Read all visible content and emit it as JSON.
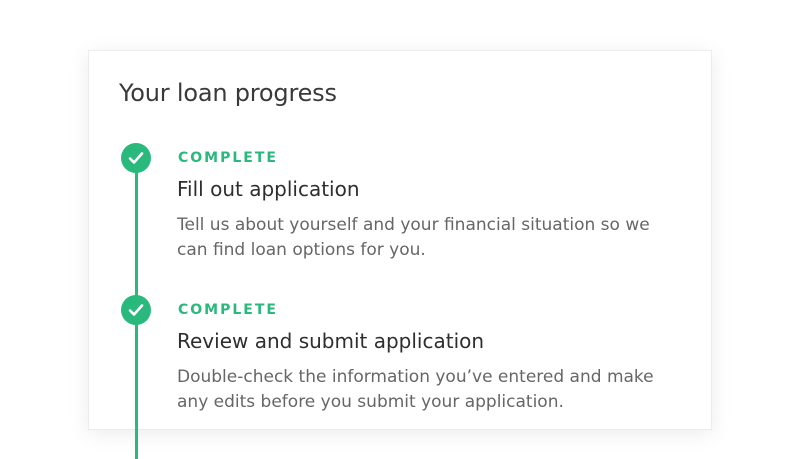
{
  "card": {
    "title": "Your loan progress"
  },
  "steps": [
    {
      "status": "COMPLETE",
      "title": "Fill out application",
      "description": "Tell us about yourself and your financial situation so we can find loan options for you.",
      "icon": "check-icon"
    },
    {
      "status": "COMPLETE",
      "title": "Review and submit application",
      "description": "Double-check the information you’ve entered and make any edits before you submit your application.",
      "icon": "check-icon"
    }
  ],
  "colors": {
    "accent": "#2ab97c",
    "title": "#3a3a3a",
    "body_text": "#666666"
  }
}
